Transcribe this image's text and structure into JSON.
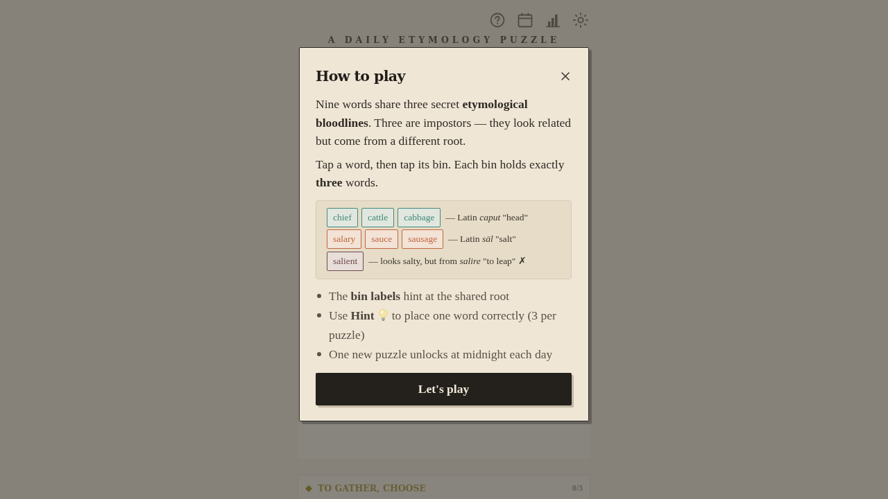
{
  "header": {
    "subtitle": "A DAILY ETYMOLOGY PUZZLE"
  },
  "modal": {
    "title": "How to play",
    "paragraphs": [
      "Nine words share three secret **etymological bloodlines**. Three are impostors — they look related but come from a different root.",
      "Tap a word, then tap its bin. Each bin holds exactly **three** words."
    ],
    "example": {
      "rows": [
        {
          "color": "#3f8a7a",
          "words": [
            "chief",
            "cattle",
            "cabbage"
          ],
          "note": "— Latin *caput* \"head\""
        },
        {
          "color": "#c0673f",
          "words": [
            "salary",
            "sauce",
            "sausage"
          ],
          "note": "— Latin *sāl* \"salt\""
        },
        {
          "color": "#6e4a52",
          "words": [
            "salient"
          ],
          "note": "— looks salty, but from *salire* \"to leap\" ✗"
        }
      ]
    },
    "tips": [
      {
        "kind": "text",
        "text": "The **bin labels** hint at the shared root"
      },
      {
        "kind": "hint",
        "before": "Use **Hint**",
        "after": "to place one word correctly (3 per puzzle)"
      },
      {
        "kind": "text",
        "text": "One new puzzle unlocks at midnight each day"
      }
    ],
    "button": "Let's play"
  },
  "bins": [
    {
      "label": "TO GATHER, CHOOSE",
      "count": "0/3"
    }
  ]
}
